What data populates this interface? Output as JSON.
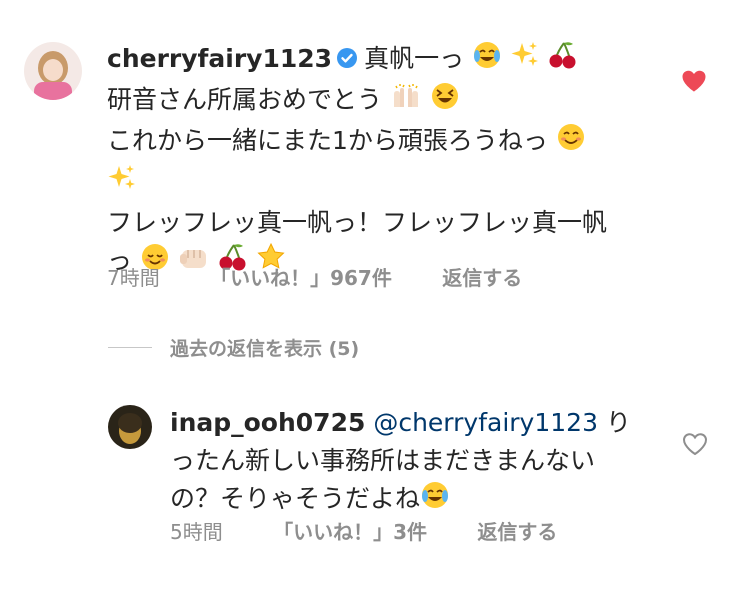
{
  "comment1": {
    "username": "cherryfairy1123",
    "line1": "真帆一っ",
    "line2": "研音さん所属おめでとう",
    "line3": "これから一緒にまた1から頑張ろうねっ",
    "line5": "フレッフレッ真一帆っ！フレッフレッ真一帆",
    "line6": "っ",
    "time": "7時間",
    "likes": "「いいね！」967件",
    "reply": "返信する",
    "liked": true
  },
  "view_replies": "過去の返信を表示 (5)",
  "comment2": {
    "username": "inap_ooh0725",
    "mention": "@cherryfairy1123",
    "line1_tail": "り",
    "line2": "ったん新しい事務所はまだきまんない",
    "line3": "の？そりゃそうだよね",
    "time": "5時間",
    "likes": "「いいね！」3件",
    "reply": "返信する",
    "liked": false
  },
  "colors": {
    "heart_filled": "#ed4956",
    "meta": "#8e8e8e",
    "mention": "#00376b",
    "verified": "#3897f0"
  },
  "icons": [
    "verified-badge-icon",
    "crying-laughing-emoji",
    "sparkles-emoji",
    "cherries-emoji",
    "raising-hands-emoji",
    "grinning-squinting-emoji",
    "smiling-blush-emoji",
    "relieved-smile-emoji",
    "fist-emoji",
    "star-emoji",
    "heart-filled-icon",
    "heart-outline-icon"
  ]
}
